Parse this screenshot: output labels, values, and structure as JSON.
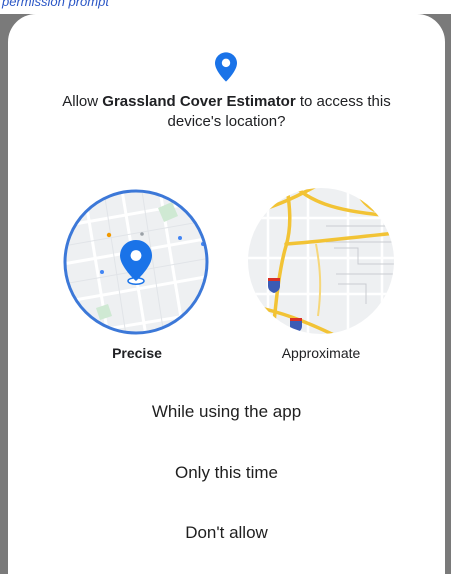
{
  "header": {
    "partial_text": "permission prompt"
  },
  "dialog": {
    "prompt_prefix": "Allow ",
    "app_name": "Grassland Cover Estimator",
    "prompt_suffix": " to access this device's location?",
    "options": {
      "precise_label": "Precise",
      "approximate_label": "Approximate",
      "selected": "Precise"
    },
    "actions": {
      "while_using": "While using the app",
      "only_this_time": "Only this time",
      "dont_allow": "Don't allow"
    }
  },
  "colors": {
    "accent": "#1a73e8",
    "selection_ring": "#3c78d8",
    "road_major": "#f2c335",
    "map_background": "#eef0f2"
  },
  "icons": {
    "location_pin": "location-pin-icon"
  }
}
